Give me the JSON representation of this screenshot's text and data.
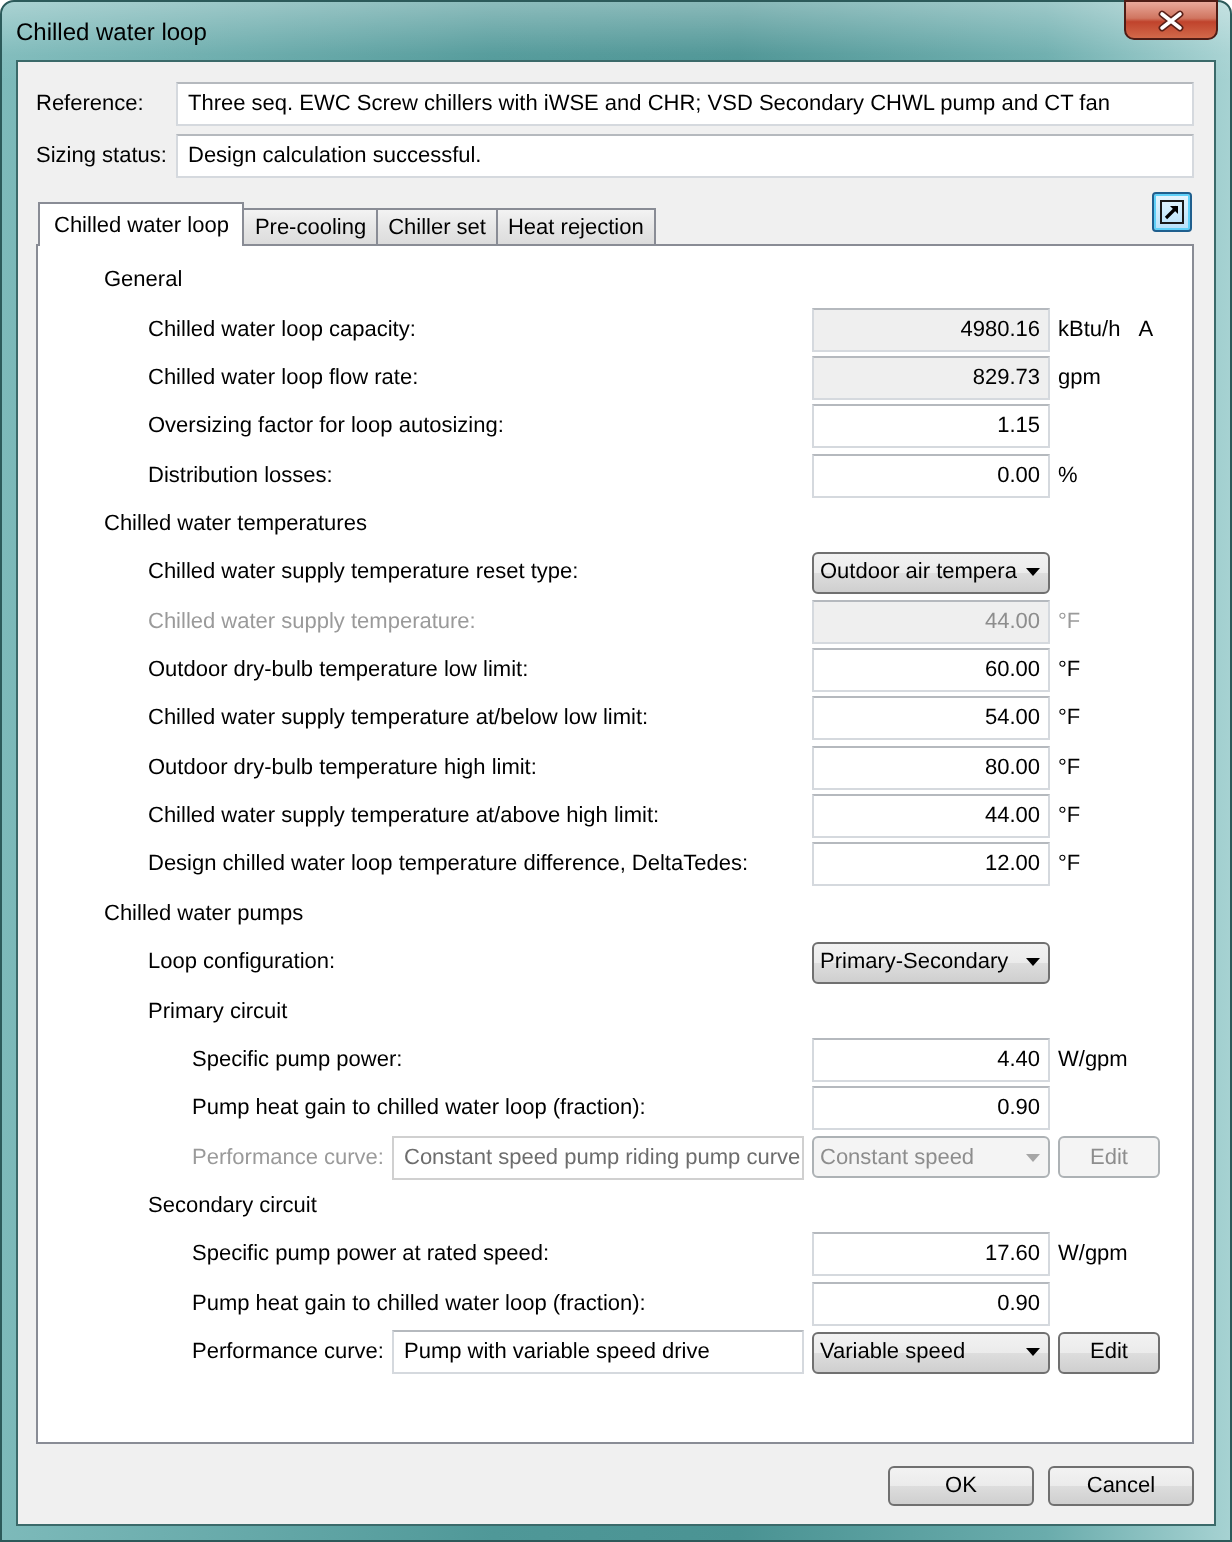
{
  "window": {
    "title": "Chilled water loop"
  },
  "header_fields": [
    {
      "label": "Reference:",
      "value": "Three seq. EWC Screw chillers with iWSE and CHR; VSD Secondary CHWL pump and CT fan"
    },
    {
      "label": "Sizing status:",
      "value": "Design calculation successful."
    }
  ],
  "tabs": [
    {
      "label": "Chilled water loop",
      "selected": true
    },
    {
      "label": "Pre-cooling",
      "selected": false
    },
    {
      "label": "Chiller set",
      "selected": false
    },
    {
      "label": "Heat rejection",
      "selected": false
    }
  ],
  "popout_button": {
    "highlighted": true
  },
  "sections": [
    {
      "heading": "General",
      "rows": [
        {
          "kind": "number",
          "label": "Chilled water loop capacity:",
          "value": "4980.16",
          "unit": "kBtu/h",
          "flag": "A",
          "readonly": true,
          "disabled": false
        },
        {
          "kind": "number",
          "label": "Chilled water loop flow rate:",
          "value": "829.73",
          "unit": "gpm",
          "readonly": true,
          "disabled": false
        },
        {
          "kind": "number",
          "label": "Oversizing factor for loop autosizing:",
          "value": "1.15",
          "readonly": false,
          "disabled": false
        },
        {
          "kind": "number",
          "label": "Distribution losses:",
          "value": "0.00",
          "unit": "%",
          "readonly": false,
          "disabled": false
        }
      ]
    },
    {
      "heading": "Chilled water temperatures",
      "rows": [
        {
          "kind": "dropdown",
          "label": "Chilled water supply temperature reset type:",
          "value": "Outdoor air tempera",
          "disabled": false
        },
        {
          "kind": "number",
          "label": "Chilled water supply temperature:",
          "value": "44.00",
          "unit": "°F",
          "readonly": true,
          "disabled": true
        },
        {
          "kind": "number",
          "label": "Outdoor dry-bulb temperature low limit:",
          "value": "60.00",
          "unit": "°F",
          "readonly": false,
          "disabled": false
        },
        {
          "kind": "number",
          "label": "Chilled water supply temperature at/below low limit:",
          "value": "54.00",
          "unit": "°F",
          "readonly": false,
          "disabled": false
        },
        {
          "kind": "number",
          "label": "Outdoor dry-bulb temperature high limit:",
          "value": "80.00",
          "unit": "°F",
          "readonly": false,
          "disabled": false
        },
        {
          "kind": "number",
          "label": "Chilled water supply temperature at/above high limit:",
          "value": "44.00",
          "unit": "°F",
          "readonly": false,
          "disabled": false
        },
        {
          "kind": "number",
          "label": "Design chilled water loop temperature difference, DeltaTedes:",
          "value": "12.00",
          "unit": "°F",
          "readonly": false,
          "disabled": false
        }
      ]
    },
    {
      "heading": "Chilled water pumps",
      "rows": [
        {
          "kind": "dropdown",
          "label": "Loop configuration:",
          "value": "Primary-Secondary",
          "disabled": false
        },
        {
          "kind": "group",
          "label": "Primary circuit",
          "disabled": false,
          "children": [
            {
              "kind": "number",
              "label": "Specific pump power:",
              "value": "4.40",
              "unit": "W/gpm",
              "readonly": false,
              "disabled": false
            },
            {
              "kind": "number",
              "label": "Pump heat gain to chilled water loop (fraction):",
              "value": "0.90",
              "readonly": false,
              "disabled": false
            },
            {
              "kind": "curve",
              "label": "Performance curve:",
              "curve": "Constant speed pump riding pump curve",
              "value": "Constant speed",
              "button": "Edit",
              "disabled": true
            }
          ]
        },
        {
          "kind": "group",
          "label": "Secondary circuit",
          "disabled": false,
          "children": [
            {
              "kind": "number",
              "label": "Specific pump power at rated speed:",
              "value": "17.60",
              "unit": "W/gpm",
              "readonly": false,
              "disabled": false
            },
            {
              "kind": "number",
              "label": "Pump heat gain to chilled water loop (fraction):",
              "value": "0.90",
              "readonly": false,
              "disabled": false
            },
            {
              "kind": "curve",
              "label": "Performance curve:",
              "curve": "Pump with variable speed drive",
              "value": "Variable speed",
              "button": "Edit",
              "disabled": false
            }
          ]
        }
      ]
    }
  ],
  "buttons": [
    {
      "label": "OK"
    },
    {
      "label": "Cancel"
    }
  ]
}
